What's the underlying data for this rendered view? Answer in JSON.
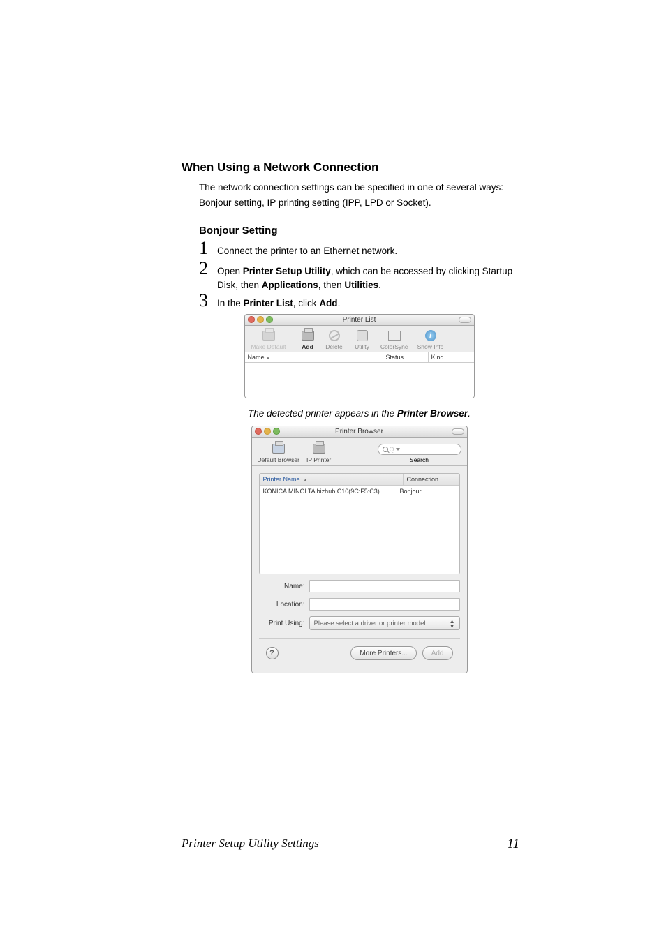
{
  "heading1": "When Using a Network Connection",
  "intro1": "The network connection settings can be specified in one of several ways:",
  "intro2": "Bonjour setting, IP printing setting (IPP, LPD or Socket).",
  "heading2": "Bonjour Setting",
  "steps": {
    "s1": {
      "num": "1",
      "text": "Connect the printer to an Ethernet network."
    },
    "s2": {
      "num": "2",
      "pre": "Open ",
      "b1": "Printer Setup Utility",
      "mid1": ", which can be accessed by clicking Startup",
      "line2a": "Disk, then ",
      "b2": "Applications",
      "mid2": ", then ",
      "b3": "Utilities",
      "end": "."
    },
    "s3": {
      "num": "3",
      "pre": "In the ",
      "b1": "Printer List",
      "mid": ", click ",
      "b2": "Add",
      "end": "."
    }
  },
  "printerList": {
    "title": "Printer List",
    "toolbar": {
      "makeDefault": "Make Default",
      "add": "Add",
      "delete": "Delete",
      "utility": "Utility",
      "colorsync": "ColorSync",
      "showInfo": "Show Info"
    },
    "cols": {
      "name": "Name",
      "status": "Status",
      "kind": "Kind"
    }
  },
  "captionPre": "The detected printer appears in the ",
  "captionBold": "Printer Browser",
  "captionEnd": ".",
  "browser": {
    "title": "Printer Browser",
    "tabs": {
      "defaultBrowser": "Default Browser",
      "ipPrinter": "IP Printer",
      "search": "Search"
    },
    "searchPlaceholder": "Q",
    "listCols": {
      "name": "Printer Name",
      "conn": "Connection"
    },
    "row": {
      "name": "KONICA MINOLTA bizhub C10(9C:F5:C3)",
      "conn": "Bonjour"
    },
    "formLabels": {
      "name": "Name:",
      "location": "Location:",
      "printUsing": "Print Using:"
    },
    "printUsingValue": "Please select a driver or printer model",
    "buttons": {
      "more": "More Printers...",
      "add": "Add",
      "help": "?"
    }
  },
  "footer": {
    "left": "Printer Setup Utility Settings",
    "right": "11"
  }
}
